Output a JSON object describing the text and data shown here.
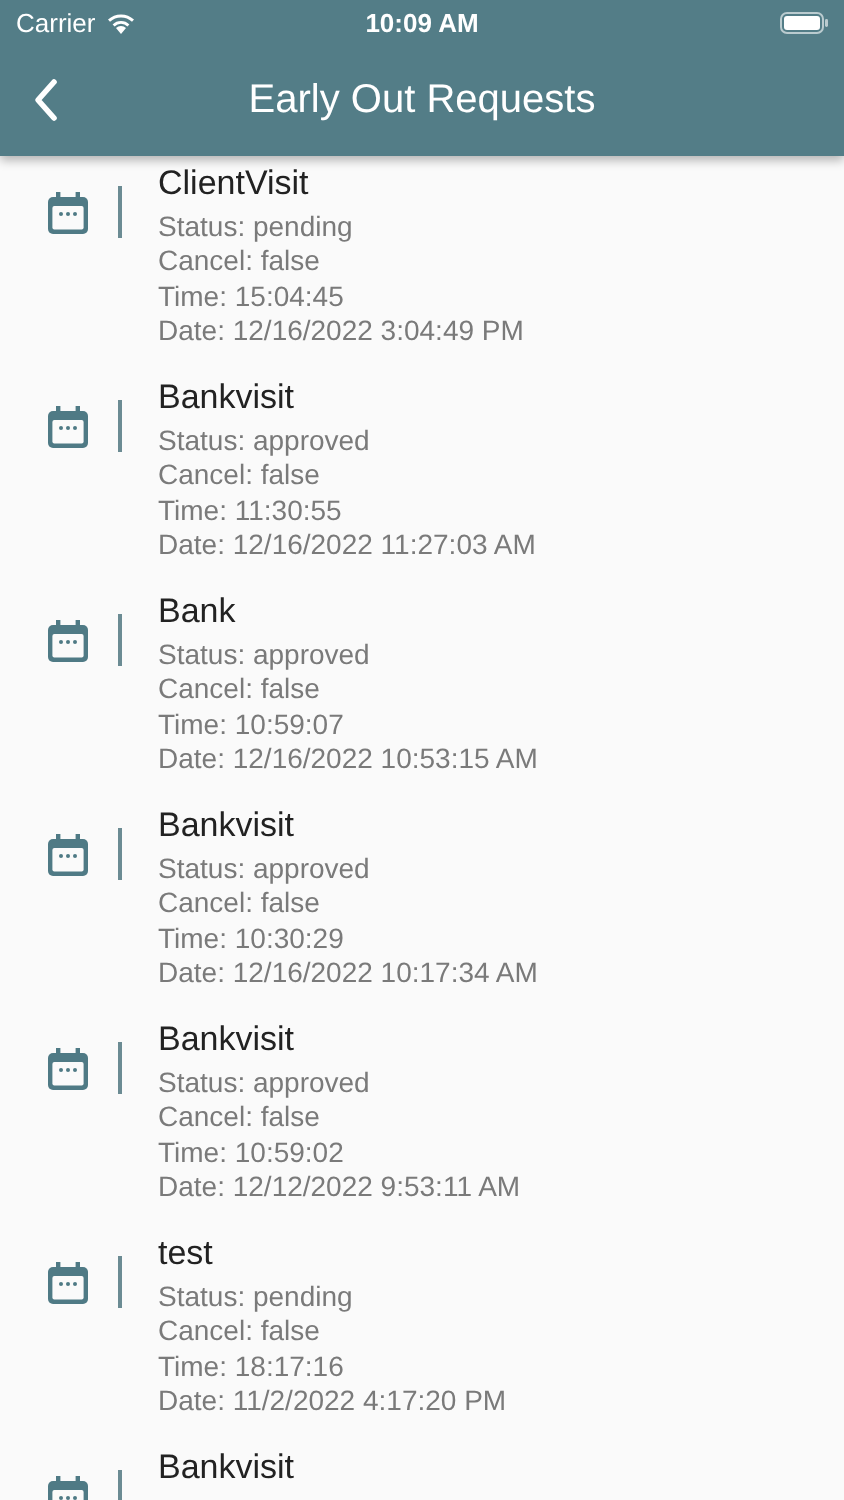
{
  "status_bar": {
    "carrier": "Carrier",
    "time": "10:09 AM"
  },
  "header": {
    "title": "Early Out Requests"
  },
  "requests": [
    {
      "title": "ClientVisit",
      "lines": [
        "Status: pending",
        "Cancel: false",
        "Time: 15:04:45",
        "Date: 12/16/2022 3:04:49 PM"
      ]
    },
    {
      "title": "Bankvisit",
      "lines": [
        "Status: approved",
        "Cancel: false",
        "Time: 11:30:55",
        "Date: 12/16/2022 11:27:03 AM"
      ]
    },
    {
      "title": "Bank",
      "lines": [
        "Status: approved",
        "Cancel: false",
        "Time: 10:59:07",
        "Date: 12/16/2022 10:53:15 AM"
      ]
    },
    {
      "title": "Bankvisit",
      "lines": [
        "Status: approved",
        "Cancel: false",
        "Time: 10:30:29",
        "Date: 12/16/2022 10:17:34 AM"
      ]
    },
    {
      "title": "Bankvisit",
      "lines": [
        "Status: approved",
        "Cancel: false",
        "Time: 10:59:02",
        "Date: 12/12/2022 9:53:11 AM"
      ]
    },
    {
      "title": "test",
      "lines": [
        "Status: pending",
        "Cancel: false",
        "Time: 18:17:16",
        "Date: 11/2/2022 4:17:20 PM"
      ]
    },
    {
      "title": "Bankvisit"
    }
  ]
}
